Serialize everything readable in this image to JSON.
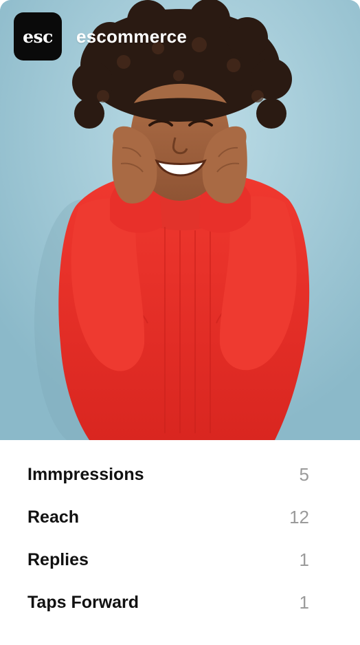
{
  "account": {
    "avatar_text": "esc",
    "name": "escommerce"
  },
  "story": {
    "image_description_icon": "photo-woman-red-sweater",
    "background_color": "#a3cbd8",
    "sweater_color": "#e8302a"
  },
  "metrics": [
    {
      "label": "Immpressions",
      "value": "5"
    },
    {
      "label": "Reach",
      "value": "12"
    },
    {
      "label": "Replies",
      "value": "1"
    },
    {
      "label": "Taps Forward",
      "value": "1"
    }
  ]
}
